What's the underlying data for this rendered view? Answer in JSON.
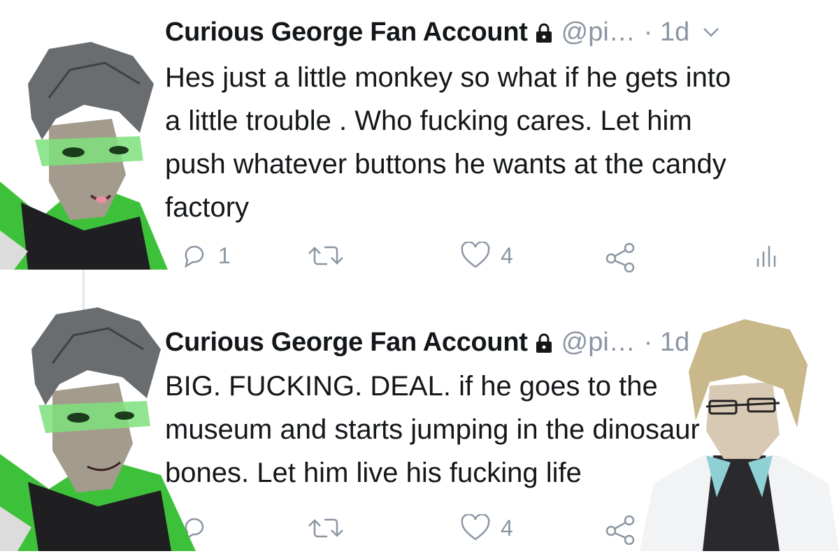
{
  "tweets": [
    {
      "author_name": "Curious George Fan Account",
      "handle": "@pi…",
      "time": "· 1d",
      "body_lines": [
        "Hes just a little monkey so what if he gets into",
        "a little trouble . Who fucking cares. Let him",
        "push whatever buttons he wants at the candy",
        "factory"
      ],
      "reply_count": "1",
      "retweet_count": "",
      "like_count": "4"
    },
    {
      "author_name": "Curious George Fan Account",
      "handle": "@pi…",
      "time": "· 1d",
      "body_lines": [
        "BIG. FUCKING. DEAL. if he goes to the",
        "museum and starts jumping in the dinosaur",
        "bones. Let him live his fucking life"
      ],
      "reply_count": "",
      "retweet_count": "",
      "like_count": "4"
    }
  ],
  "icons": {
    "lock": "lock-icon",
    "caret": "chevron-down-icon",
    "reply": "reply-icon",
    "retweet": "retweet-icon",
    "like": "heart-icon",
    "share": "share-icon",
    "stats": "analytics-icon"
  },
  "colors": {
    "text": "#14171a",
    "muted": "#8a96a3",
    "thread_line": "#e1e8ed",
    "costume_green": "#3ec13a"
  }
}
